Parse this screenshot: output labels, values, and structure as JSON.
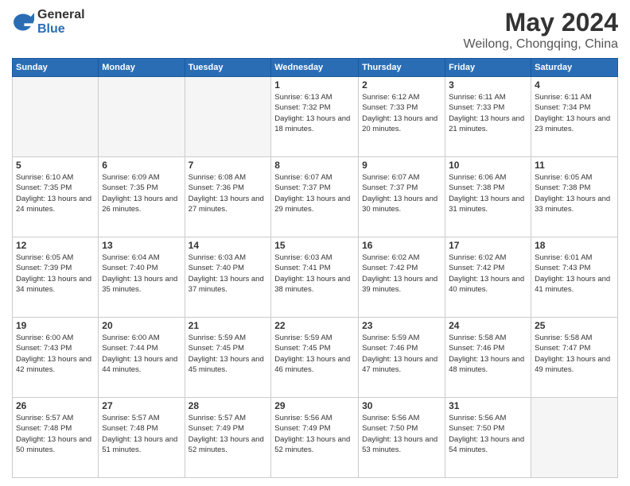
{
  "logo": {
    "general": "General",
    "blue": "Blue"
  },
  "title": "May 2024",
  "subtitle": "Weilong, Chongqing, China",
  "days_of_week": [
    "Sunday",
    "Monday",
    "Tuesday",
    "Wednesday",
    "Thursday",
    "Friday",
    "Saturday"
  ],
  "weeks": [
    [
      {
        "day": "",
        "empty": true
      },
      {
        "day": "",
        "empty": true
      },
      {
        "day": "",
        "empty": true
      },
      {
        "day": "1",
        "sunrise": "6:13 AM",
        "sunset": "7:32 PM",
        "daylight": "13 hours and 18 minutes."
      },
      {
        "day": "2",
        "sunrise": "6:12 AM",
        "sunset": "7:33 PM",
        "daylight": "13 hours and 20 minutes."
      },
      {
        "day": "3",
        "sunrise": "6:11 AM",
        "sunset": "7:33 PM",
        "daylight": "13 hours and 21 minutes."
      },
      {
        "day": "4",
        "sunrise": "6:11 AM",
        "sunset": "7:34 PM",
        "daylight": "13 hours and 23 minutes."
      }
    ],
    [
      {
        "day": "5",
        "sunrise": "6:10 AM",
        "sunset": "7:35 PM",
        "daylight": "13 hours and 24 minutes."
      },
      {
        "day": "6",
        "sunrise": "6:09 AM",
        "sunset": "7:35 PM",
        "daylight": "13 hours and 26 minutes."
      },
      {
        "day": "7",
        "sunrise": "6:08 AM",
        "sunset": "7:36 PM",
        "daylight": "13 hours and 27 minutes."
      },
      {
        "day": "8",
        "sunrise": "6:07 AM",
        "sunset": "7:37 PM",
        "daylight": "13 hours and 29 minutes."
      },
      {
        "day": "9",
        "sunrise": "6:07 AM",
        "sunset": "7:37 PM",
        "daylight": "13 hours and 30 minutes."
      },
      {
        "day": "10",
        "sunrise": "6:06 AM",
        "sunset": "7:38 PM",
        "daylight": "13 hours and 31 minutes."
      },
      {
        "day": "11",
        "sunrise": "6:05 AM",
        "sunset": "7:38 PM",
        "daylight": "13 hours and 33 minutes."
      }
    ],
    [
      {
        "day": "12",
        "sunrise": "6:05 AM",
        "sunset": "7:39 PM",
        "daylight": "13 hours and 34 minutes."
      },
      {
        "day": "13",
        "sunrise": "6:04 AM",
        "sunset": "7:40 PM",
        "daylight": "13 hours and 35 minutes."
      },
      {
        "day": "14",
        "sunrise": "6:03 AM",
        "sunset": "7:40 PM",
        "daylight": "13 hours and 37 minutes."
      },
      {
        "day": "15",
        "sunrise": "6:03 AM",
        "sunset": "7:41 PM",
        "daylight": "13 hours and 38 minutes."
      },
      {
        "day": "16",
        "sunrise": "6:02 AM",
        "sunset": "7:42 PM",
        "daylight": "13 hours and 39 minutes."
      },
      {
        "day": "17",
        "sunrise": "6:02 AM",
        "sunset": "7:42 PM",
        "daylight": "13 hours and 40 minutes."
      },
      {
        "day": "18",
        "sunrise": "6:01 AM",
        "sunset": "7:43 PM",
        "daylight": "13 hours and 41 minutes."
      }
    ],
    [
      {
        "day": "19",
        "sunrise": "6:00 AM",
        "sunset": "7:43 PM",
        "daylight": "13 hours and 42 minutes."
      },
      {
        "day": "20",
        "sunrise": "6:00 AM",
        "sunset": "7:44 PM",
        "daylight": "13 hours and 44 minutes."
      },
      {
        "day": "21",
        "sunrise": "5:59 AM",
        "sunset": "7:45 PM",
        "daylight": "13 hours and 45 minutes."
      },
      {
        "day": "22",
        "sunrise": "5:59 AM",
        "sunset": "7:45 PM",
        "daylight": "13 hours and 46 minutes."
      },
      {
        "day": "23",
        "sunrise": "5:59 AM",
        "sunset": "7:46 PM",
        "daylight": "13 hours and 47 minutes."
      },
      {
        "day": "24",
        "sunrise": "5:58 AM",
        "sunset": "7:46 PM",
        "daylight": "13 hours and 48 minutes."
      },
      {
        "day": "25",
        "sunrise": "5:58 AM",
        "sunset": "7:47 PM",
        "daylight": "13 hours and 49 minutes."
      }
    ],
    [
      {
        "day": "26",
        "sunrise": "5:57 AM",
        "sunset": "7:48 PM",
        "daylight": "13 hours and 50 minutes."
      },
      {
        "day": "27",
        "sunrise": "5:57 AM",
        "sunset": "7:48 PM",
        "daylight": "13 hours and 51 minutes."
      },
      {
        "day": "28",
        "sunrise": "5:57 AM",
        "sunset": "7:49 PM",
        "daylight": "13 hours and 52 minutes."
      },
      {
        "day": "29",
        "sunrise": "5:56 AM",
        "sunset": "7:49 PM",
        "daylight": "13 hours and 52 minutes."
      },
      {
        "day": "30",
        "sunrise": "5:56 AM",
        "sunset": "7:50 PM",
        "daylight": "13 hours and 53 minutes."
      },
      {
        "day": "31",
        "sunrise": "5:56 AM",
        "sunset": "7:50 PM",
        "daylight": "13 hours and 54 minutes."
      },
      {
        "day": "",
        "empty": true
      }
    ]
  ]
}
